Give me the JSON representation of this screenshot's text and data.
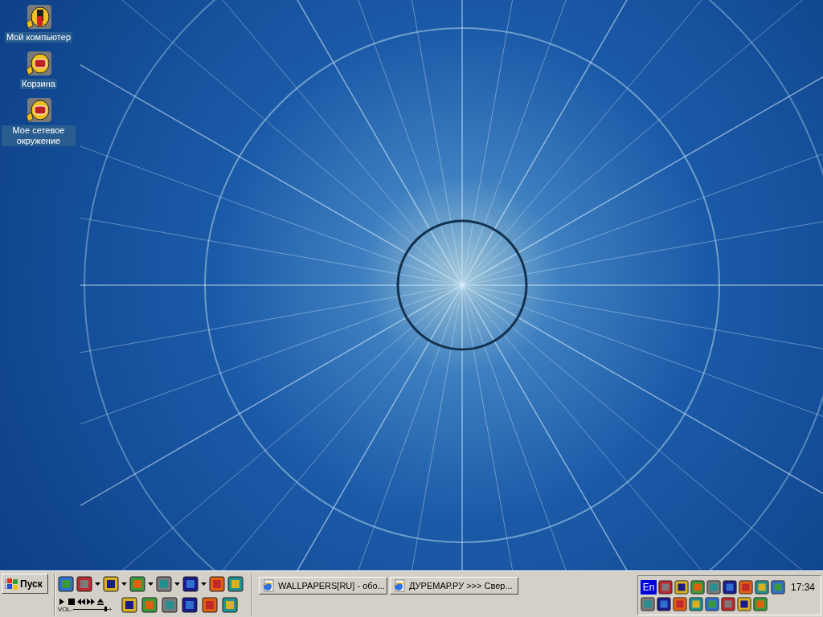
{
  "desktop": {
    "icons": [
      {
        "label": "Мой компьютер"
      },
      {
        "label": "Корзина"
      },
      {
        "label": "Мое сетевое окружение"
      }
    ]
  },
  "taskbar": {
    "start_button": {
      "label": "Пуск"
    },
    "quick_launch": {
      "top_row": [
        {
          "menu": false
        },
        {
          "menu": true
        },
        {
          "menu": true
        },
        {
          "menu": true
        },
        {
          "menu": true
        },
        {
          "menu": true
        },
        {
          "menu": false
        },
        {
          "menu": false
        }
      ],
      "player": {
        "volume_label": "VOL-",
        "volume_plus": "+",
        "level": 0.95
      }
    },
    "tasks": [
      {
        "label": "WALLPAPERS[RU] - обо...",
        "selected": false
      },
      {
        "label": "ДУРЕМАР.РУ >>> Свер...",
        "selected": false
      }
    ],
    "tray": {
      "language": "En",
      "clock": "17:34"
    }
  }
}
